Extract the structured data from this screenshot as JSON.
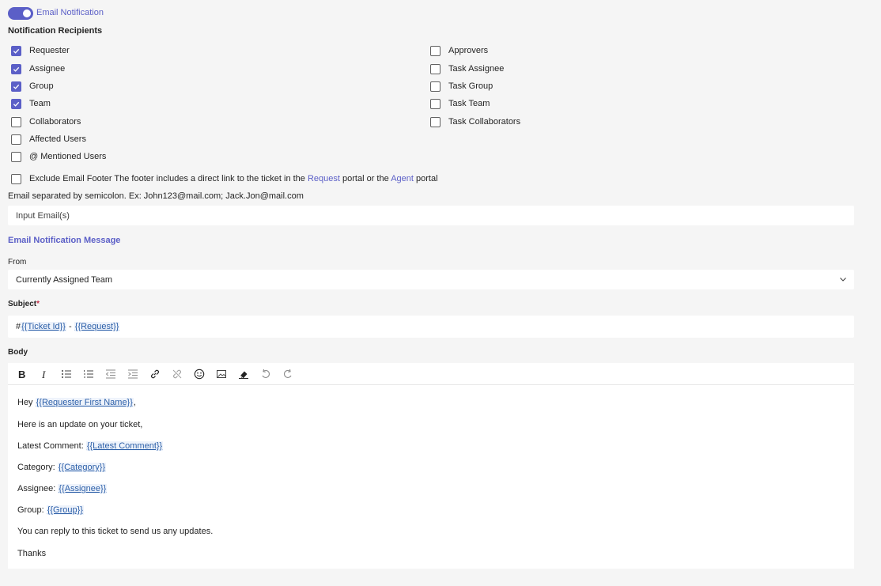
{
  "toggle": {
    "label": "Email Notification",
    "on": true
  },
  "recipients": {
    "title": "Notification Recipients",
    "left": [
      {
        "label": "Requester",
        "checked": true
      },
      {
        "label": "Assignee",
        "checked": true
      },
      {
        "label": "Group",
        "checked": true
      },
      {
        "label": "Team",
        "checked": true
      },
      {
        "label": "Collaborators",
        "checked": false
      },
      {
        "label": "Affected Users",
        "checked": false
      },
      {
        "label": "@ Mentioned Users",
        "checked": false
      }
    ],
    "right": [
      {
        "label": "Approvers",
        "checked": false
      },
      {
        "label": "Task Assignee",
        "checked": false
      },
      {
        "label": "Task Group",
        "checked": false
      },
      {
        "label": "Task Team",
        "checked": false
      },
      {
        "label": "Task Collaborators",
        "checked": false
      }
    ]
  },
  "exclude_footer": {
    "text_before": "Exclude Email Footer The footer includes a direct link to the ticket in the ",
    "link1": "Request",
    "text_mid": " portal or the ",
    "link2": "Agent",
    "text_after": " portal",
    "checked": false
  },
  "email_hint": "Email separated by semicolon. Ex: John123@mail.com; Jack.Jon@mail.com",
  "email_input": {
    "placeholder": "Input Email(s)",
    "value": ""
  },
  "message_title": "Email Notification Message",
  "from": {
    "label": "From",
    "value": "Currently Assigned Team"
  },
  "subject": {
    "label": "Subject",
    "required_mark": "*",
    "prefix": "#",
    "token1": "{{Ticket Id}}",
    "separator": " - ",
    "token2": "{{Request}}"
  },
  "body": {
    "label": "Body",
    "toolbar": [
      "bold-icon",
      "italic-icon",
      "bulleted-list-icon",
      "numbered-list-icon",
      "decrease-indent-icon",
      "increase-indent-icon",
      "link-icon",
      "unlink-icon",
      "emoji-icon",
      "image-icon",
      "clear-format-icon",
      "undo-icon",
      "redo-icon"
    ],
    "lines": [
      {
        "text": "Hey ",
        "token": "{{Requester First Name}}",
        "after": ","
      },
      {
        "text": "Here is an update on your ticket,",
        "token": "",
        "after": ""
      },
      {
        "text": "Latest Comment: ",
        "token": "{{Latest Comment}}",
        "after": ""
      },
      {
        "text": "Category: ",
        "token": "{{Category}}",
        "after": ""
      },
      {
        "text": "Assignee: ",
        "token": "{{Assignee}}",
        "after": ""
      },
      {
        "text": "Group: ",
        "token": "{{Group}}",
        "after": ""
      },
      {
        "text": "You can reply to this ticket to send us any updates.",
        "token": "",
        "after": ""
      },
      {
        "text": "Thanks",
        "token": "",
        "after": ""
      }
    ]
  },
  "colors": {
    "accent": "#5b5fc7",
    "token": "#2c5fa8"
  }
}
